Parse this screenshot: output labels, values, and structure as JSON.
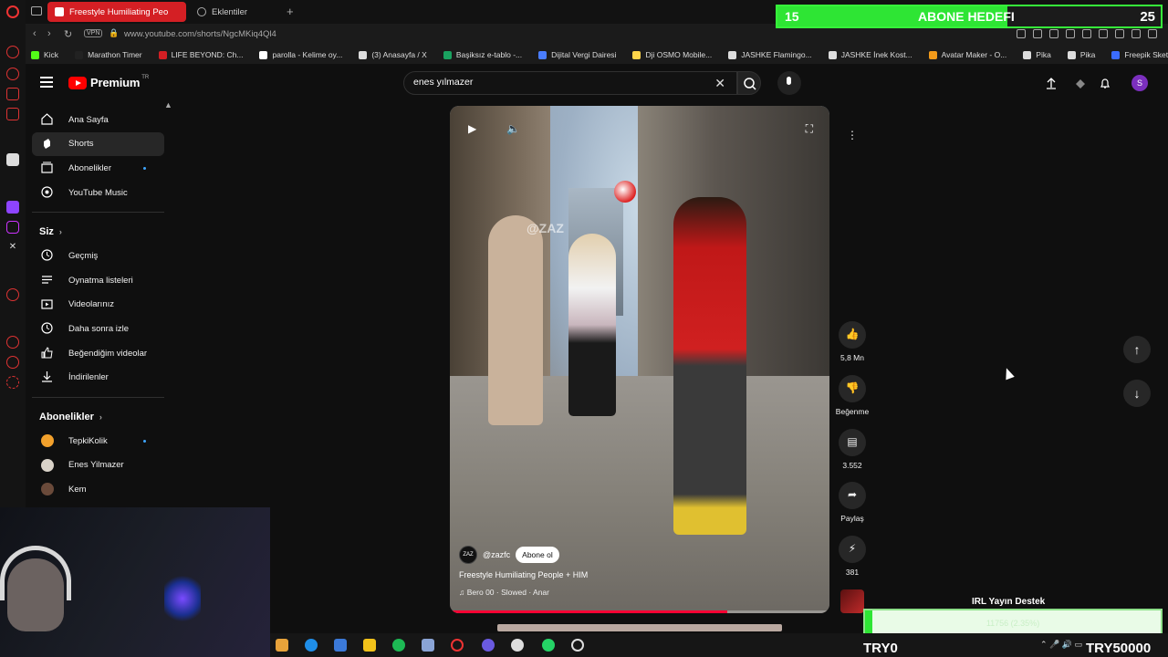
{
  "browser": {
    "active_tab": "Freestyle Humiliating Peo",
    "ext_tab": "Eklentiler",
    "new_tab": "+",
    "url": "www.youtube.com/shorts/NgcMKiq4Ql4",
    "vpn": "VPN",
    "bookmarks": [
      "Kick",
      "Marathon Timer",
      "LIFE BEYOND: Ch...",
      "parolla - Kelime oy...",
      "(3) Anasayfa / X",
      "Başiksız e-tablo -...",
      "Dijital Vergi Dairesi",
      "Dji OSMO Mobile...",
      "JASHKE Flamingo...",
      "JASHKE İnek Kost...",
      "Avatar Maker - O...",
      "Pika",
      "Pika",
      "Freepik Sketch - F..."
    ]
  },
  "goal": {
    "left": "15",
    "title": "ABONE HEDEFI",
    "right": "25",
    "progress": 0.6
  },
  "header": {
    "logo": "Premium",
    "region": "TR",
    "search_value": "enes yılmazer",
    "avatar": "S"
  },
  "sidebar": {
    "main": [
      "Ana Sayfa",
      "Shorts",
      "Abonelikler",
      "YouTube Music"
    ],
    "you_title": "Siz",
    "you": [
      "Geçmiş",
      "Oynatma listeleri",
      "Videolarınız",
      "Daha sonra izle",
      "Beğendiğim videolar",
      "İndirilenler"
    ],
    "subs_title": "Abonelikler",
    "subs": [
      "TepkiKolik",
      "Enes Yilmazer",
      "Kem"
    ]
  },
  "video": {
    "watermark": "@ZAZ",
    "channel": "@zazfc",
    "channel_logo": "ZAZ",
    "subscribe": "Abone ol",
    "title": "Freestyle Humiliating People + HIM",
    "song": "Bero 00 · Slowed · Anar",
    "progress": 0.73
  },
  "actions": {
    "likes": "5,8 Mn",
    "dislike": "Beğenme",
    "comments": "3.552",
    "share": "Paylaş",
    "remix": "381"
  },
  "overlay": {
    "support_title": "IRL Yayın Destek",
    "support_value": "11756 (2.35%)",
    "support_progress": 0.0235,
    "try_left": "TRY0",
    "try_right": "TRY50000"
  },
  "colors": {
    "yt_red": "#ff0000",
    "goal_green": "#2ee534",
    "tab_red": "#d41f24"
  }
}
